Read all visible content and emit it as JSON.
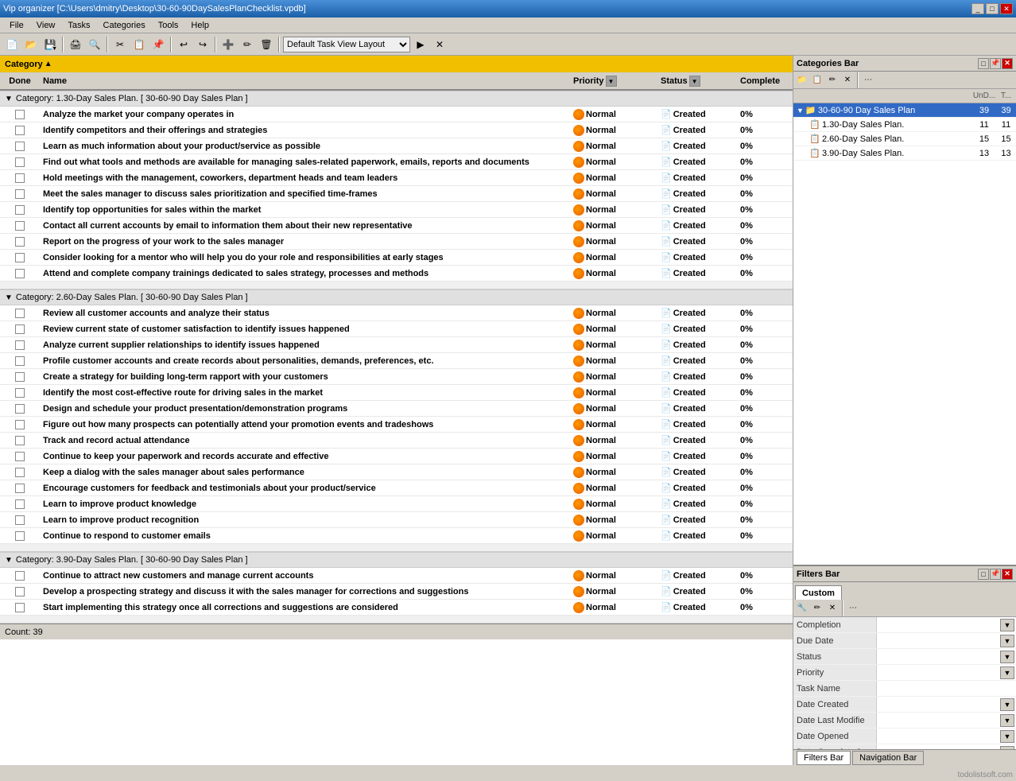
{
  "titleBar": {
    "title": "Vip organizer [C:\\Users\\dmitry\\Desktop\\30-60-90DaySalesPlanChecklist.vpdb]",
    "controls": [
      "_",
      "□",
      "✕"
    ]
  },
  "menuBar": {
    "items": [
      "File",
      "View",
      "Tasks",
      "Categories",
      "Tools",
      "Help"
    ]
  },
  "toolbar": {
    "layoutLabel": "Default Task View Layout"
  },
  "catHeader": {
    "label": "Category"
  },
  "columns": {
    "done": "Done",
    "name": "Name",
    "priority": "Priority",
    "status": "Status",
    "complete": "Complete"
  },
  "sections": [
    {
      "id": "section1",
      "label": "Category: 1.30-Day Sales Plan.   [ 30-60-90 Day Sales Plan ]",
      "tasks": [
        {
          "name": "Analyze the market your company operates in",
          "priority": "Normal",
          "status": "Created",
          "complete": "0%"
        },
        {
          "name": "Identify competitors and their offerings and strategies",
          "priority": "Normal",
          "status": "Created",
          "complete": "0%"
        },
        {
          "name": "Learn as much information about your product/service as possible",
          "priority": "Normal",
          "status": "Created",
          "complete": "0%"
        },
        {
          "name": "Find out what tools and methods are available for managing sales-related paperwork, emails, reports and documents",
          "priority": "Normal",
          "status": "Created",
          "complete": "0%"
        },
        {
          "name": "Hold meetings with the management, coworkers, department heads and team leaders",
          "priority": "Normal",
          "status": "Created",
          "complete": "0%"
        },
        {
          "name": "Meet the sales manager to discuss sales prioritization and specified time-frames",
          "priority": "Normal",
          "status": "Created",
          "complete": "0%"
        },
        {
          "name": "Identify top  opportunities for sales within the market",
          "priority": "Normal",
          "status": "Created",
          "complete": "0%"
        },
        {
          "name": "Contact all current accounts by email to information them about their new representative",
          "priority": "Normal",
          "status": "Created",
          "complete": "0%"
        },
        {
          "name": "Report on the progress of your work to the sales manager",
          "priority": "Normal",
          "status": "Created",
          "complete": "0%"
        },
        {
          "name": "Consider looking for a mentor who will help you do your role and responsibilities at early stages",
          "priority": "Normal",
          "status": "Created",
          "complete": "0%"
        },
        {
          "name": "Attend and complete company trainings dedicated to sales strategy, processes and methods",
          "priority": "Normal",
          "status": "Created",
          "complete": "0%"
        }
      ]
    },
    {
      "id": "section2",
      "label": "Category: 2.60-Day Sales Plan.   [ 30-60-90 Day Sales Plan ]",
      "tasks": [
        {
          "name": "Review all  customer accounts and analyze their status",
          "priority": "Normal",
          "status": "Created",
          "complete": "0%"
        },
        {
          "name": "Review current state of customer satisfaction  to identify issues happened",
          "priority": "Normal",
          "status": "Created",
          "complete": "0%"
        },
        {
          "name": "Analyze current supplier relationships to identify issues happened",
          "priority": "Normal",
          "status": "Created",
          "complete": "0%"
        },
        {
          "name": "Profile customer accounts and create records about personalities, demands, preferences, etc.",
          "priority": "Normal",
          "status": "Created",
          "complete": "0%"
        },
        {
          "name": "Create a strategy for building long-term rapport with your customers",
          "priority": "Normal",
          "status": "Created",
          "complete": "0%"
        },
        {
          "name": "Identify the most cost-effective route for driving sales in the market",
          "priority": "Normal",
          "status": "Created",
          "complete": "0%"
        },
        {
          "name": "Design and schedule your product presentation/demonstration programs",
          "priority": "Normal",
          "status": "Created",
          "complete": "0%"
        },
        {
          "name": "Figure out how many prospects can potentially attend your promotion events and tradeshows",
          "priority": "Normal",
          "status": "Created",
          "complete": "0%"
        },
        {
          "name": "Track and record actual attendance",
          "priority": "Normal",
          "status": "Created",
          "complete": "0%"
        },
        {
          "name": "Continue to keep your paperwork and records accurate and effective",
          "priority": "Normal",
          "status": "Created",
          "complete": "0%"
        },
        {
          "name": "Keep a dialog with the sales manager about sales performance",
          "priority": "Normal",
          "status": "Created",
          "complete": "0%"
        },
        {
          "name": "Encourage customers for feedback and testimonials about your product/service",
          "priority": "Normal",
          "status": "Created",
          "complete": "0%"
        },
        {
          "name": "Learn to improve product knowledge",
          "priority": "Normal",
          "status": "Created",
          "complete": "0%"
        },
        {
          "name": "Learn to improve product recognition",
          "priority": "Normal",
          "status": "Created",
          "complete": "0%"
        },
        {
          "name": "Continue to respond to customer emails",
          "priority": "Normal",
          "status": "Created",
          "complete": "0%"
        }
      ]
    },
    {
      "id": "section3",
      "label": "Category: 3.90-Day Sales Plan.   [ 30-60-90 Day Sales Plan ]",
      "tasks": [
        {
          "name": "Continue to attract new customers and manage current accounts",
          "priority": "Normal",
          "status": "Created",
          "complete": "0%"
        },
        {
          "name": "Develop a prospecting strategy and discuss it with the sales manager for corrections and suggestions",
          "priority": "Normal",
          "status": "Created",
          "complete": "0%"
        },
        {
          "name": "Start implementing this strategy once all corrections and suggestions are considered",
          "priority": "Normal",
          "status": "Created",
          "complete": "0%"
        }
      ]
    }
  ],
  "statusBar": {
    "count": "Count: 39"
  },
  "categoriesBar": {
    "title": "Categories Bar",
    "controls": [
      "□",
      "📌",
      "✕"
    ],
    "treeHeaders": {
      "name": "UnD...",
      "t": "T..."
    },
    "items": [
      {
        "level": 0,
        "icon": "📁",
        "label": "30-60-90 Day Sales Plan",
        "und": "39",
        "t": "39",
        "expanded": true
      },
      {
        "level": 1,
        "icon": "📋",
        "label": "1.30-Day Sales Plan.",
        "und": "11",
        "t": "11"
      },
      {
        "level": 1,
        "icon": "📋",
        "label": "2.60-Day Sales Plan.",
        "und": "15",
        "t": "15"
      },
      {
        "level": 1,
        "icon": "📋",
        "label": "3.90-Day Sales Plan.",
        "und": "13",
        "t": "13"
      }
    ]
  },
  "filtersBar": {
    "title": "Filters Bar",
    "tabs": [
      "Custom"
    ],
    "filterRows": [
      {
        "label": "Completion",
        "value": "",
        "hasDropdown": true
      },
      {
        "label": "Due Date",
        "value": "",
        "hasDropdown": true
      },
      {
        "label": "Status",
        "value": "",
        "hasDropdown": true
      },
      {
        "label": "Priority",
        "value": "",
        "hasDropdown": true
      },
      {
        "label": "Task Name",
        "value": "",
        "hasDropdown": false
      },
      {
        "label": "Date Created",
        "value": "",
        "hasDropdown": true
      },
      {
        "label": "Date Last Modifie",
        "value": "",
        "hasDropdown": true
      },
      {
        "label": "Date Opened",
        "value": "",
        "hasDropdown": true
      },
      {
        "label": "Date Completed",
        "value": "",
        "hasDropdown": true
      }
    ]
  },
  "bottomTabs": [
    "Filters Bar",
    "Navigation Bar"
  ],
  "watermark": "todolistsoft.com"
}
